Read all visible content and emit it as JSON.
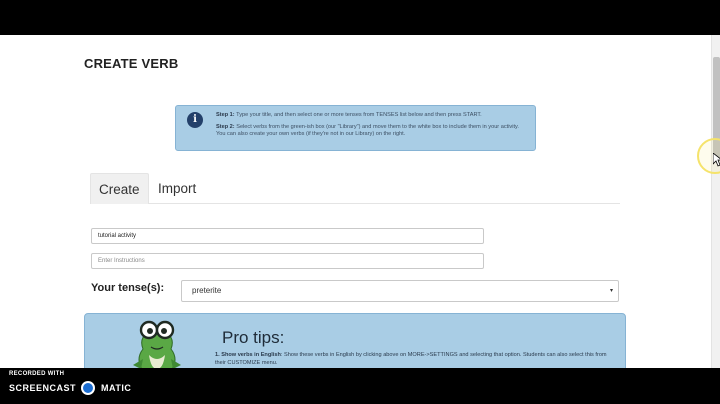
{
  "page": {
    "title": "CREATE VERB"
  },
  "info": {
    "step1_label": "Step 1:",
    "step1_text": " Type your title, and then select one or more tenses from TENSES list below and then press START.",
    "step2_label": "Step 2:",
    "step2_text": " Select verbs from the green-ish box (our \"Library\") and move them to the white box to include them in your activity. You can also create your own verbs (if they're not in our Library) on the right.",
    "icon": "info-icon"
  },
  "tabs": [
    {
      "label": "Create",
      "active": true
    },
    {
      "label": "Import",
      "active": false
    }
  ],
  "form": {
    "title_value": "tutorial activity",
    "instructions_placeholder": "Enter Instructions",
    "tense_label": "Your tense(s):",
    "tense_value": "preterite",
    "tense_caret": "▾"
  },
  "pro_tips": {
    "title": "Pro tips:",
    "tip1_label": "1. Show verbs in English",
    "tip1_text": ": Show these verbs in English by clicking above on MORE->SETTINGS and selecting that option. Students can also select this from their CUSTOMIZE menu."
  },
  "recorder": {
    "line1": "RECORDED WITH",
    "line2": "SCREENCAST",
    "line3": "MATIC"
  },
  "colors": {
    "info_bg": "#a9cde5",
    "info_border": "#86b3d4",
    "icon_bg": "#23406a",
    "frog_green": "#5aa845",
    "screencast_blue": "#1b6dd1"
  }
}
